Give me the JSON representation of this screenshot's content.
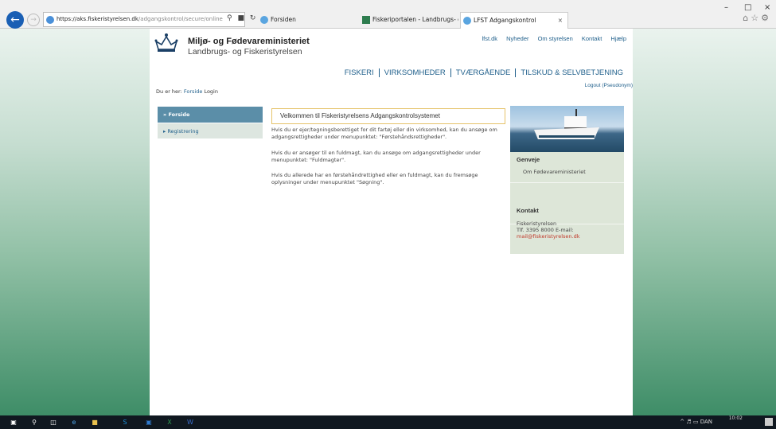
{
  "browser": {
    "url_main": "https://aks.fiskeristyrelsen.dk",
    "url_path": "/adgangskontrol/secure/online",
    "tabs": [
      {
        "label": "Forsiden"
      },
      {
        "label": "Fiskeriportalen - Landbrugs- o..."
      },
      {
        "label": "LFST Adgangskontrol"
      }
    ],
    "tab_close": "×"
  },
  "header": {
    "ministry": "Miljø- og Fødevareministeriet",
    "agency": "Landbrugs- og Fiskeristyrelsen",
    "top_links": [
      "lfst.dk",
      "Nyheder",
      "Om styrelsen",
      "Kontakt",
      "Hjælp"
    ],
    "main_nav": [
      "FISKERI",
      "VIRKSOMHEDER",
      "TVÆRGÅENDE",
      "TILSKUD & SELVBETJENING"
    ],
    "logout": "Logout (Pseudonym)"
  },
  "breadcrumb": {
    "prefix": "Du er her:",
    "home": "Forside",
    "current": "Login"
  },
  "left_nav": [
    {
      "label": "» Forside"
    },
    {
      "label": "▸ Registrering"
    }
  ],
  "main": {
    "welcome": "Velkommen til Fiskeristyrelsens Adgangskontrolsystemet",
    "paragraphs": [
      "Hvis du er ejer/tegningsberettiget for dit fartøj eller din virksomhed, kan du ansøge om adgangsrettigheder under menupunktet: \"Førstehåndsrettigheder\".",
      "Hvis du er ansøger til en fuldmagt, kan du ansøge om adgangsrettigheder under menupunktet: \"Fuldmagter\".",
      "Hvis du allerede har en førstehåndrettighed eller en fuldmagt, kan du fremsøge oplysninger under menupunktet \"Søgning\"."
    ]
  },
  "right": {
    "genveje_title": "Genveje",
    "genveje_link": "Om Fødevareministeriet",
    "kontakt_title": "Kontakt",
    "kontakt_name": "Fiskeristyrelsen",
    "kontakt_phone": "Tlf. 3395 8000 E-mail:",
    "kontakt_email": "mail@fiskeristyrelsen.dk"
  },
  "taskbar": {
    "lang": "DAN",
    "time": "10:02"
  },
  "colors": {
    "link": "#1f5f8b",
    "active_nav": "#5b8ea8",
    "accent_border": "#e6c36a"
  }
}
